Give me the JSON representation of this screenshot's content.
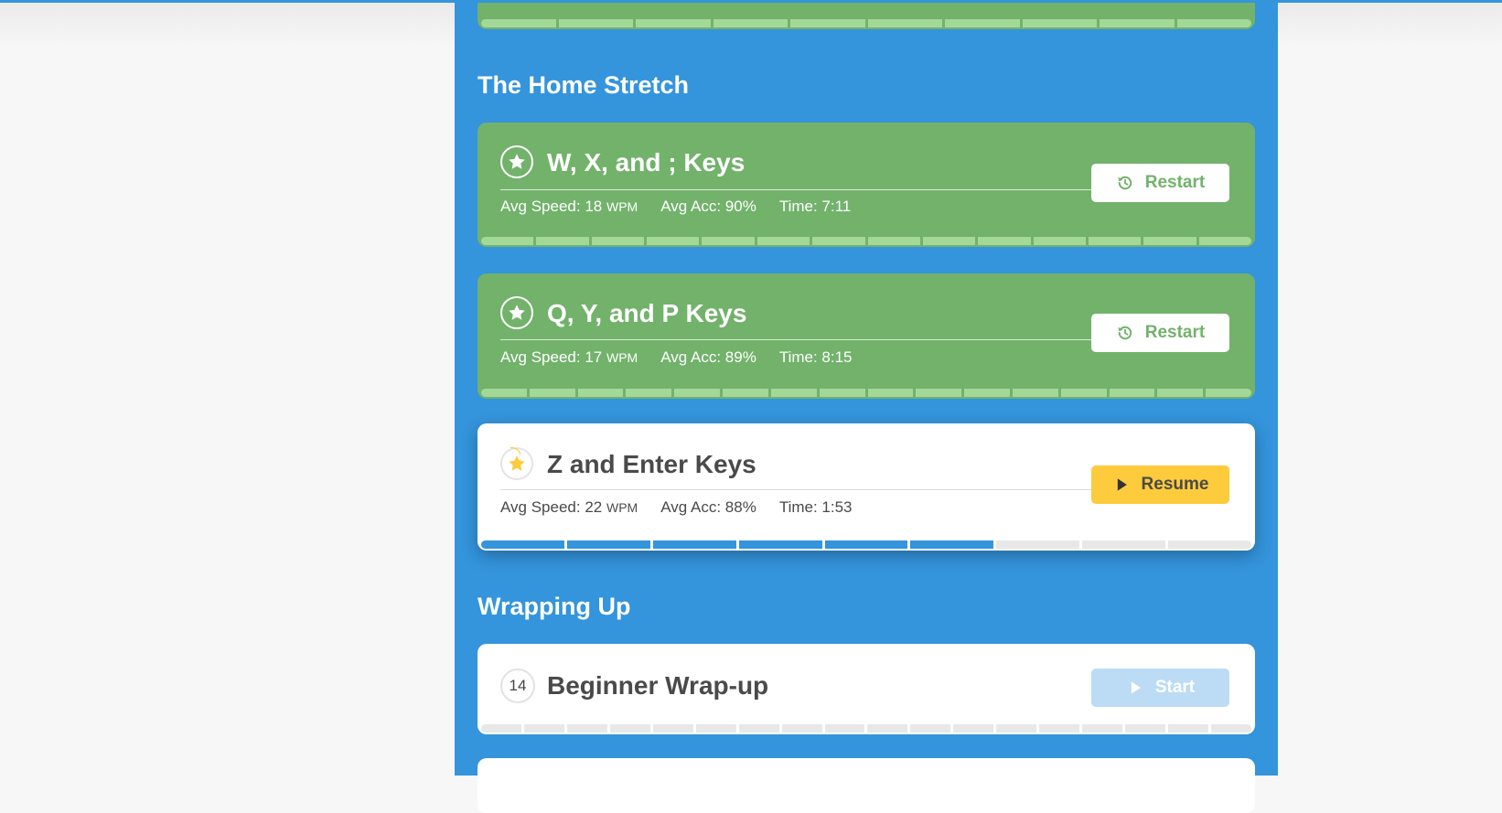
{
  "sections": [
    {
      "title": "The Home Stretch"
    },
    {
      "title": "Wrapping Up"
    }
  ],
  "lessons": [
    {
      "title": "W, X, and ; Keys",
      "speed_label": "Avg Speed:",
      "speed": "18",
      "speed_unit": "WPM",
      "acc_label": "Avg Acc:",
      "acc": "90%",
      "time_label": "Time:",
      "time": "7:11",
      "button": "Restart",
      "status": "completed",
      "progress_total": 14,
      "progress_done": 14
    },
    {
      "title": "Q, Y, and P Keys",
      "speed_label": "Avg Speed:",
      "speed": "17",
      "speed_unit": "WPM",
      "acc_label": "Avg Acc:",
      "acc": "89%",
      "time_label": "Time:",
      "time": "8:15",
      "button": "Restart",
      "status": "completed",
      "progress_total": 16,
      "progress_done": 16
    },
    {
      "title": "Z and Enter Keys",
      "speed_label": "Avg Speed:",
      "speed": "22",
      "speed_unit": "WPM",
      "acc_label": "Avg Acc:",
      "acc": "88%",
      "time_label": "Time:",
      "time": "1:53",
      "button": "Resume",
      "status": "in-progress",
      "progress_total": 9,
      "progress_done": 6
    },
    {
      "number": "14",
      "title": "Beginner Wrap-up",
      "button": "Start",
      "status": "locked",
      "progress_total": 18,
      "progress_done": 0
    }
  ],
  "top_card": {
    "progress_total": 10,
    "progress_done": 10
  },
  "colors": {
    "panel": "#3494dc",
    "completed": "#72b26b",
    "completed_seg": "#a3d898",
    "resume": "#fdcb3c",
    "start_disabled": "#bcdcf5",
    "star_gold": "#fdcb3c"
  },
  "icons": {
    "completed": "star-icon",
    "restart": "history-icon",
    "resume": "play-icon",
    "start": "play-icon"
  }
}
